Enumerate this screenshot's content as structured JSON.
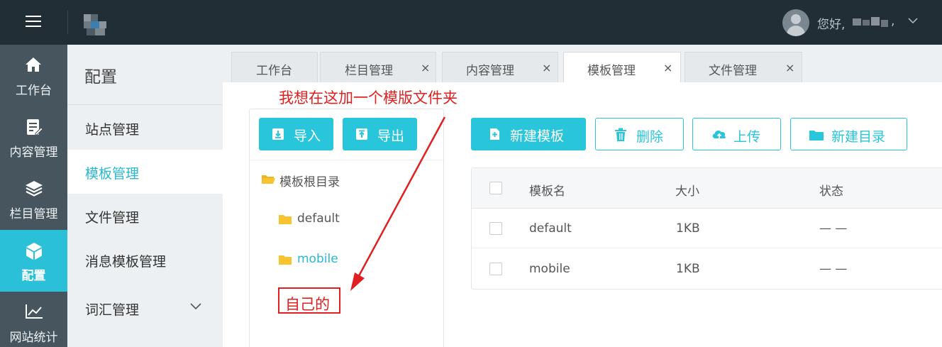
{
  "header": {
    "greeting": "您好,",
    "comma": ","
  },
  "nav": {
    "items": [
      {
        "label": "工作台",
        "icon": "home-icon"
      },
      {
        "label": "内容管理",
        "icon": "document-edit-icon"
      },
      {
        "label": "栏目管理",
        "icon": "layers-icon"
      },
      {
        "label": "配置",
        "icon": "cube-icon",
        "active": true
      },
      {
        "label": "网站统计",
        "icon": "line-chart-icon"
      }
    ]
  },
  "submenu": {
    "title": "配置",
    "items": [
      {
        "label": "站点管理"
      },
      {
        "label": "模板管理",
        "active": true
      },
      {
        "label": "文件管理"
      },
      {
        "label": "消息模板管理"
      },
      {
        "label": "词汇管理",
        "has_children": true
      }
    ]
  },
  "tabs": [
    {
      "label": "工作台",
      "closable": false
    },
    {
      "label": "栏目管理",
      "closable": true
    },
    {
      "label": "内容管理",
      "closable": true
    },
    {
      "label": "模板管理",
      "closable": true,
      "active": true
    },
    {
      "label": "文件管理",
      "closable": true
    }
  ],
  "tab_close_glyph": "×",
  "toolbar": {
    "import_label": "导入",
    "export_label": "导出",
    "new_template_label": "新建模板",
    "delete_label": "删除",
    "upload_label": "上传",
    "new_dir_label": "新建目录"
  },
  "tree": {
    "root_label": "模板根目录",
    "children": [
      {
        "label": "default"
      },
      {
        "label": "mobile",
        "selected": true
      }
    ]
  },
  "annotations": {
    "arrow_text": "我想在这加一个模版文件夹",
    "box_text": "自己的",
    "color": "#e02020"
  },
  "table": {
    "columns": [
      "模板名",
      "大小",
      "状态"
    ],
    "rows": [
      {
        "name": "default",
        "size": "1KB",
        "status": "— —"
      },
      {
        "name": "mobile",
        "size": "1KB",
        "status": "— —"
      }
    ]
  },
  "colors": {
    "accent": "#29c5da",
    "topbar": "#222e36",
    "sidenav": "#46555e",
    "folder": "#f7c32e"
  }
}
